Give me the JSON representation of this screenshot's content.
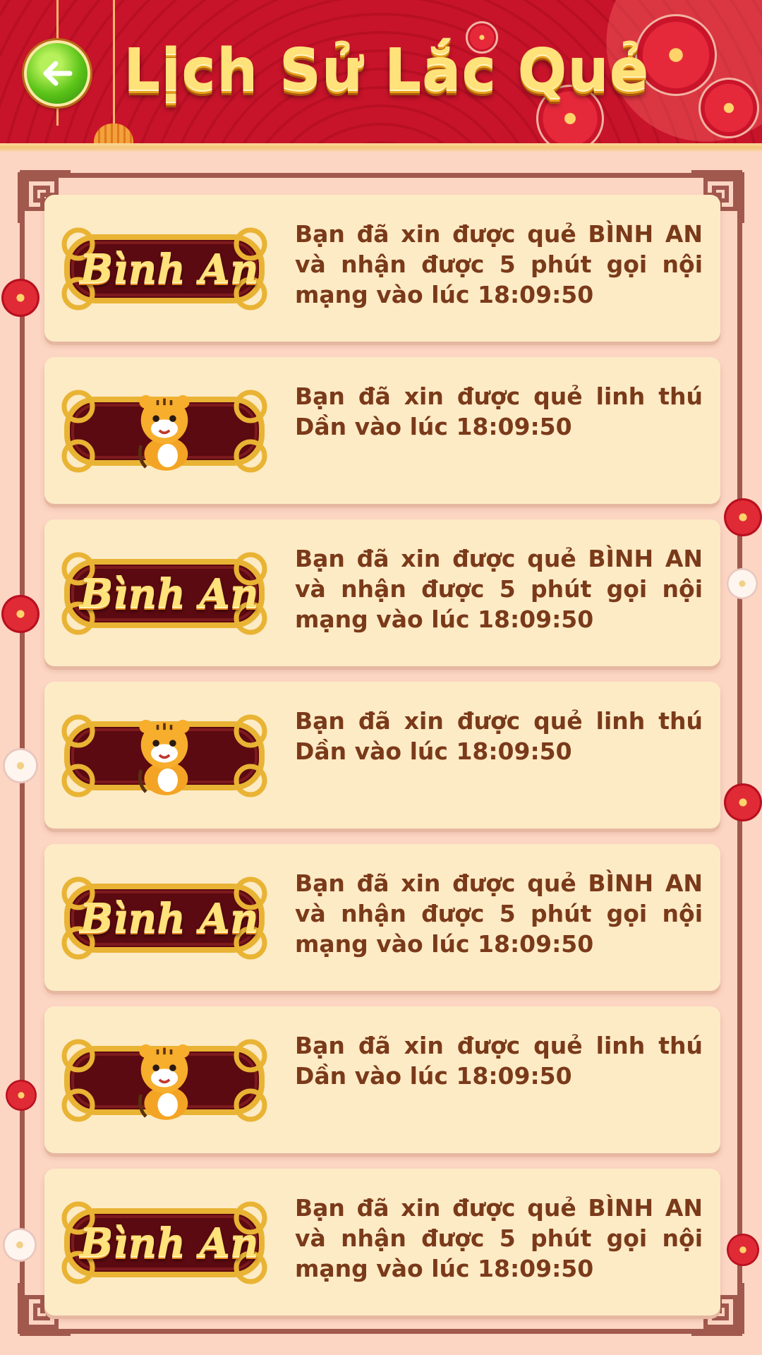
{
  "header": {
    "title": "Lịch Sử Lắc Quẻ",
    "back_icon": "arrow-left-icon"
  },
  "colors": {
    "header_red": "#c01327",
    "page_background": "#fcd5c3",
    "card_background": "#fdebc6",
    "text_brown": "#7a3a1a",
    "plaque_maroon": "#5a0a10",
    "gold": "#e9b334"
  },
  "history": [
    {
      "plaque_type": "binh-an",
      "plaque_label": "Bình An",
      "text": "Bạn đã xin được quẻ BÌNH AN và nhận được 5 phút gọi nội mạng vào lúc 18:09:50"
    },
    {
      "plaque_type": "tiger",
      "plaque_label": "",
      "text": "Bạn đã xin được quẻ linh thú Dần vào lúc 18:09:50"
    },
    {
      "plaque_type": "binh-an",
      "plaque_label": "Bình An",
      "text": "Bạn đã xin được quẻ BÌNH AN và nhận được 5 phút gọi nội mạng vào lúc 18:09:50"
    },
    {
      "plaque_type": "tiger",
      "plaque_label": "",
      "text": "Bạn đã xin được quẻ linh thú Dần vào lúc 18:09:50"
    },
    {
      "plaque_type": "binh-an",
      "plaque_label": "Bình An",
      "text": "Bạn đã xin được quẻ BÌNH AN và nhận được 5 phút gọi nội mạng vào lúc 18:09:50"
    },
    {
      "plaque_type": "tiger",
      "plaque_label": "",
      "text": "Bạn đã xin được quẻ linh thú Dần vào lúc 18:09:50"
    },
    {
      "plaque_type": "binh-an",
      "plaque_label": "Bình An",
      "text": "Bạn đã xin được quẻ BÌNH AN và nhận được 5 phút gọi nội mạng vào lúc 18:09:50"
    }
  ]
}
